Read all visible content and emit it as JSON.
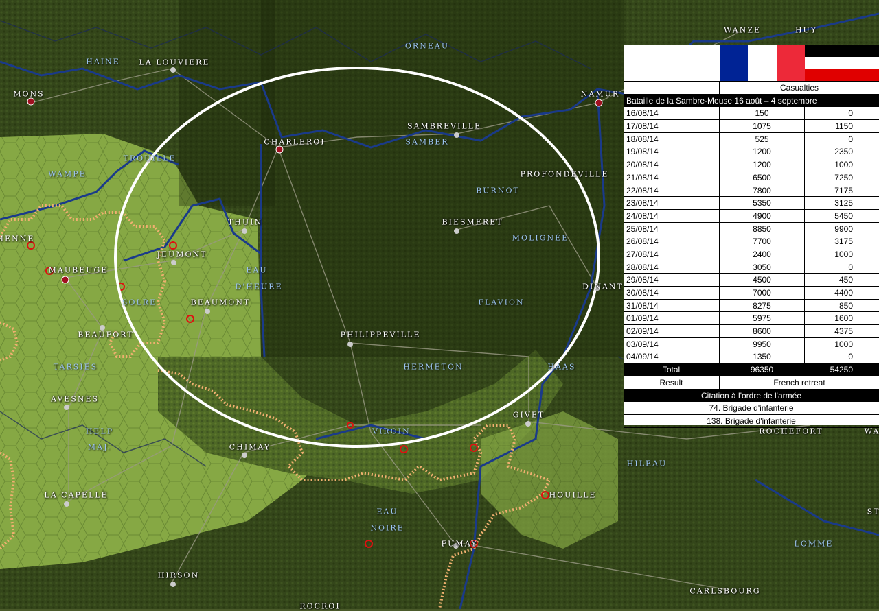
{
  "map": {
    "town_labels": [
      {
        "id": "mons",
        "text": "MONS"
      },
      {
        "id": "la-louviere",
        "text": "LA LOUVIERE"
      },
      {
        "id": "charleroi",
        "text": "CHARLEROI"
      },
      {
        "id": "sambreville",
        "text": "SAMBREVILLE"
      },
      {
        "id": "namur",
        "text": "NAMUR"
      },
      {
        "id": "wanze",
        "text": "WANZE"
      },
      {
        "id": "huy",
        "text": "HUY"
      },
      {
        "id": "profondeville",
        "text": "PROFONDEVILLE"
      },
      {
        "id": "thuin",
        "text": "THUIN"
      },
      {
        "id": "biesmeret",
        "text": "BIESMERET"
      },
      {
        "id": "jeumont",
        "text": "JEUMONT"
      },
      {
        "id": "maubeuge",
        "text": "MAUBEUGE"
      },
      {
        "id": "beaumont",
        "text": "BEAUMONT"
      },
      {
        "id": "dinant",
        "text": "DINANT"
      },
      {
        "id": "beaufort",
        "text": "BEAUFORT"
      },
      {
        "id": "philippeville",
        "text": "PHILIPPEVILLE"
      },
      {
        "id": "avesnes",
        "text": "AVESNES"
      },
      {
        "id": "givet",
        "text": "GIVET"
      },
      {
        "id": "rochefort",
        "text": "ROCHEFORT"
      },
      {
        "id": "chimay",
        "text": "CHIMAY"
      },
      {
        "id": "la-capelle",
        "text": "LA CAPELLE"
      },
      {
        "id": "houille",
        "text": "HOUILLE"
      },
      {
        "id": "fumay",
        "text": "FUMAY"
      },
      {
        "id": "hirson",
        "text": "HIRSON"
      },
      {
        "id": "carlsbourg",
        "text": "CARLSBOURG"
      },
      {
        "id": "rocroi",
        "text": "ROCROI"
      },
      {
        "id": "menne",
        "text": "MENNE"
      },
      {
        "id": "wa",
        "text": "WA"
      },
      {
        "id": "st",
        "text": "ST"
      }
    ],
    "geo_labels": [
      {
        "id": "haine",
        "text": "HAINE"
      },
      {
        "id": "orneau",
        "text": "ORNEAU"
      },
      {
        "id": "trouille",
        "text": "TROUILLE"
      },
      {
        "id": "samber",
        "text": "SAMBER"
      },
      {
        "id": "wampe",
        "text": "WAMPE"
      },
      {
        "id": "burnot",
        "text": "BURNOT"
      },
      {
        "id": "molignee",
        "text": "MOLIGNÉE"
      },
      {
        "id": "eau",
        "text": "EAU"
      },
      {
        "id": "dheure",
        "text": "D'HEURE"
      },
      {
        "id": "solre",
        "text": "SOLRE"
      },
      {
        "id": "flavion",
        "text": "FLAVION"
      },
      {
        "id": "tarsies",
        "text": "TARSIES"
      },
      {
        "id": "hermeton",
        "text": "HERMETON"
      },
      {
        "id": "haas",
        "text": "HAAS"
      },
      {
        "id": "help",
        "text": "HELP"
      },
      {
        "id": "maj",
        "text": "MAJ."
      },
      {
        "id": "viroin",
        "text": "VIROIN"
      },
      {
        "id": "hileau",
        "text": "HILEAU"
      },
      {
        "id": "eau2",
        "text": "EAU"
      },
      {
        "id": "noire",
        "text": "NOIRE"
      },
      {
        "id": "lomme",
        "text": "LOMME"
      }
    ]
  },
  "panel": {
    "header": "Casualties",
    "battle_title": "Bataille de la Sambre-Meuse 16 août – 4 septembre",
    "rows": [
      {
        "date": "16/08/14",
        "fr": "150",
        "de": "0"
      },
      {
        "date": "17/08/14",
        "fr": "1075",
        "de": "1150"
      },
      {
        "date": "18/08/14",
        "fr": "525",
        "de": "0"
      },
      {
        "date": "19/08/14",
        "fr": "1200",
        "de": "2350"
      },
      {
        "date": "20/08/14",
        "fr": "1200",
        "de": "1000"
      },
      {
        "date": "21/08/14",
        "fr": "6500",
        "de": "7250"
      },
      {
        "date": "22/08/14",
        "fr": "7800",
        "de": "7175"
      },
      {
        "date": "23/08/14",
        "fr": "5350",
        "de": "3125"
      },
      {
        "date": "24/08/14",
        "fr": "4900",
        "de": "5450"
      },
      {
        "date": "25/08/14",
        "fr": "8850",
        "de": "9900"
      },
      {
        "date": "26/08/14",
        "fr": "7700",
        "de": "3175"
      },
      {
        "date": "27/08/14",
        "fr": "2400",
        "de": "1000"
      },
      {
        "date": "28/08/14",
        "fr": "3050",
        "de": "0"
      },
      {
        "date": "29/08/14",
        "fr": "4500",
        "de": "450"
      },
      {
        "date": "30/08/14",
        "fr": "7000",
        "de": "4400"
      },
      {
        "date": "31/08/14",
        "fr": "8275",
        "de": "850"
      },
      {
        "date": "01/09/14",
        "fr": "5975",
        "de": "1600"
      },
      {
        "date": "02/09/14",
        "fr": "8600",
        "de": "4375"
      },
      {
        "date": "03/09/14",
        "fr": "9950",
        "de": "1000"
      },
      {
        "date": "04/09/14",
        "fr": "1350",
        "de": "0"
      }
    ],
    "total_label": "Total",
    "total_fr": "96350",
    "total_de": "54250",
    "result_label": "Result",
    "result_value": "French retreat",
    "citation_header": "Citation à l'ordre de l'armée",
    "citations": [
      "74. Brigade d'infanterie",
      "138. Brigade d'infanterie"
    ]
  },
  "colors": {
    "france_blue": "#002395",
    "france_red": "#ed2939",
    "forest_dark": "#2f3d16",
    "open_ground": "#7a9a3c",
    "river": "#1a3a8a",
    "highlight_ellipse": "#ffffff",
    "front_line": "#e8a050"
  }
}
